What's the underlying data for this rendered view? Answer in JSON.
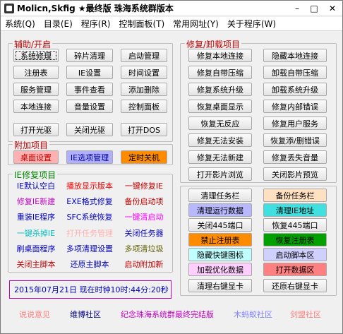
{
  "window": {
    "title": "Molicn,Skfig ★最终版 珠海系统群版本",
    "minimize": "–",
    "maximize": "□",
    "close": "✕"
  },
  "menu": [
    "系统(Q)",
    "目录(E)",
    "程序(R)",
    "控制面板(T)",
    "常用网址(Y)",
    "关于程序(W)"
  ],
  "groups": {
    "aux": "辅助/开启",
    "repair": "修复/卸载项目",
    "extra": "附加项目",
    "ie": "IE修复项目"
  },
  "aux_buttons": [
    "系统修理",
    "碎片清理",
    "启动管理",
    "注册表",
    "IE设置",
    "时间设置",
    "服务管理",
    "事件查看",
    "添加删除",
    "本地连接",
    "音量设置",
    "控制面板",
    "打开光驱",
    "关闭光驱",
    "打开DOS"
  ],
  "extra_buttons": [
    "桌面设置",
    "IE选项管理",
    "定时关机"
  ],
  "ie_items": [
    "IE默认空白",
    "播放显示版本",
    "一键修复IE",
    "修复IE新建",
    "EXE格式修复",
    "备份启动项",
    "重装IE程序",
    "SFC系统恢复",
    "一键清启动",
    "一键杀掉IE",
    "打开任务管理",
    "关闭任务器",
    "刷桌面程序",
    "多项清理设置",
    "多项清垃圾",
    "关闭主脚本",
    "还原主脚本",
    "启动附加新"
  ],
  "repair_buttons": [
    "修复本地连接",
    "隐藏本地连接",
    "修复自带压缩",
    "卸载自带压缩",
    "修复系统升级",
    "卸载系统升级",
    "恢复桌面显示",
    "修复内部错误",
    "恢复无反应",
    "修复用户服务",
    "修复无法安装",
    "恢复添/删错误",
    "修复无法新建",
    "修复丢失音量",
    "打开影片浏览",
    "关闭影片预览"
  ],
  "tool_buttons": [
    "清理任务栏",
    "备份任务栏",
    "清理运行数据",
    "清理IE地址",
    "关闭445端口",
    "恢复445端口",
    "禁止注册表",
    "恢复注册表",
    "隐藏快键图标",
    "启动脚本区",
    "加载优化数据",
    "打开数据区",
    "清理右键显卡",
    "还原右键显卡"
  ],
  "status": "2015年07月21日  现在时钟10时:44分:20秒",
  "links": [
    "说说意见",
    "维博社区",
    "纪念珠海系统群最终完结版",
    "木蚂蚁社区",
    "剑盟社区"
  ],
  "colors": {
    "accent": "#ff0000",
    "extra1": "#ffb0b0",
    "extra2": "#b0b0ff",
    "extra3": "#ff8c00"
  }
}
